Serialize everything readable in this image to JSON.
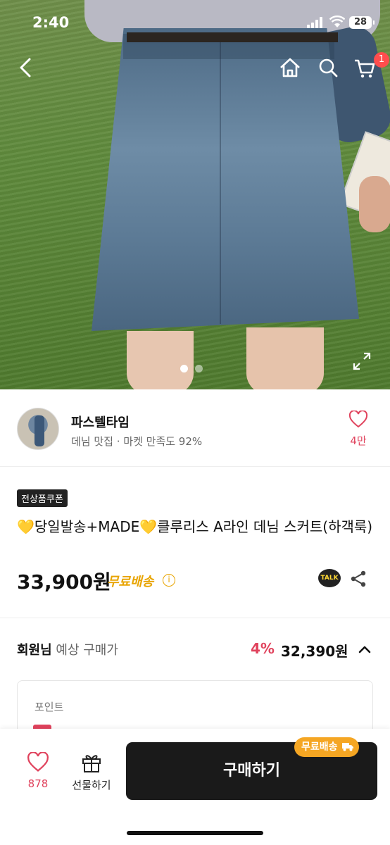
{
  "status_bar": {
    "time": "2:40",
    "battery": "28"
  },
  "nav": {
    "cart_count": "1"
  },
  "gallery": {
    "total_images": 2,
    "current_index": 1
  },
  "seller": {
    "name": "파스텔타임",
    "description": "데님 맛집 · 마켓 만족도 92%",
    "likes": "4만"
  },
  "product": {
    "coupon_badge": "전상품쿠폰",
    "title": "💛당일발송+MADE💛클루리스 A라인 데님 스커트(하객룩)",
    "price": "33,900원",
    "shipping": "무료배송",
    "talk_label": "TALK"
  },
  "member_price": {
    "label_bold": "회원님",
    "label": " 예상 구매가",
    "discount": "4%",
    "price": "32,390원"
  },
  "points": {
    "label": "포인트"
  },
  "bottom_bar": {
    "wish_count": "878",
    "gift_label": "선물하기",
    "buy_label": "구매하기",
    "free_shipping_badge": "무료배송"
  },
  "colors": {
    "accent_pink": "#e0435d",
    "free_shipping": "#e8a400",
    "buy_button": "#1a1a1a"
  }
}
